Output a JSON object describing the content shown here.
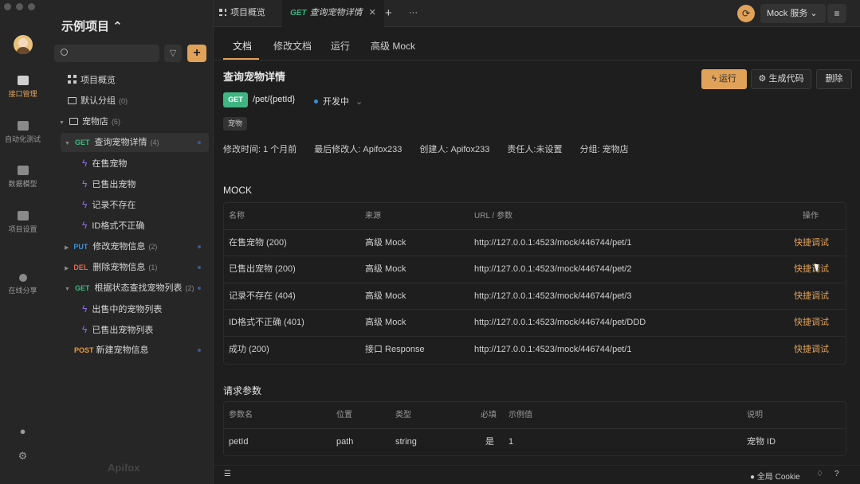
{
  "rail": {
    "items": [
      {
        "label": "接口管理",
        "icon": "api-manage-icon"
      },
      {
        "label": "自动化测试",
        "icon": "automation-icon"
      },
      {
        "label": "数据模型",
        "icon": "data-model-icon"
      },
      {
        "label": "项目设置",
        "icon": "settings-icon"
      },
      {
        "label": "在线分享",
        "icon": "share-icon"
      }
    ]
  },
  "sidebar": {
    "project_title": "示例项目 ⌃",
    "tree": {
      "overview": "项目概览",
      "default_group": "默认分组",
      "default_group_count": "(0)",
      "pet_folder": "宠物店",
      "pet_folder_count": "(5)",
      "api1": {
        "method": "GET",
        "label": "查询宠物详情",
        "count": "(4)"
      },
      "api1_cases": [
        "在售宠物",
        "已售出宠物",
        "记录不存在",
        "ID格式不正确"
      ],
      "api2": {
        "method": "PUT",
        "label": "修改宠物信息",
        "count": "(2)"
      },
      "api3": {
        "method": "DEL",
        "label": "删除宠物信息",
        "count": "(1)"
      },
      "api4": {
        "method": "GET",
        "label": "根据状态查找宠物列表",
        "count": "(2)"
      },
      "api4_cases": [
        "出售中的宠物列表",
        "已售出宠物列表"
      ],
      "api5": {
        "method": "POST",
        "label": "新建宠物信息"
      }
    },
    "brand": "Apifox"
  },
  "topbar": {
    "tab1": "项目概览",
    "tab2_method": "GET",
    "tab2_title": "查询宠物详情",
    "tab_close": "✕",
    "add": "+",
    "more": "···",
    "mock_service": "Mock 服务 ⌄",
    "accent": "#e0a259"
  },
  "subtabs": [
    "文档",
    "修改文档",
    "运行",
    "高级 Mock"
  ],
  "api": {
    "title": "查询宠物详情",
    "run": "运行",
    "gen_code": "生成代码",
    "delete": "删除",
    "method": "GET",
    "path": "/pet/{petId}",
    "status": "开发中",
    "tag": "宠物",
    "meta": {
      "modified": "修改时间: 1 个月前",
      "modifier": "最后修改人: Apifox233",
      "creator": "创建人: Apifox233",
      "owner": "责任人:未设置",
      "group": "分组: 宠物店"
    }
  },
  "mock": {
    "title": "MOCK",
    "headers": {
      "name": "名称",
      "source": "来源",
      "url": "URL / 参数",
      "action": "操作"
    },
    "rows": [
      {
        "name": "在售宠物 (200)",
        "source": "高级 Mock",
        "url": "http://127.0.0.1:4523/mock/446744/pet/1",
        "action": "快捷调试"
      },
      {
        "name": "已售出宠物 (200)",
        "source": "高级 Mock",
        "url": "http://127.0.0.1:4523/mock/446744/pet/2",
        "action": "快捷调试"
      },
      {
        "name": "记录不存在 (404)",
        "source": "高级 Mock",
        "url": "http://127.0.0.1:4523/mock/446744/pet/3",
        "action": "快捷调试"
      },
      {
        "name": "ID格式不正确 (401)",
        "source": "高级 Mock",
        "url": "http://127.0.0.1:4523/mock/446744/pet/DDD",
        "action": "快捷调试"
      },
      {
        "name": "成功 (200)",
        "source": "接口 Response",
        "url": "http://127.0.0.1:4523/mock/446744/pet/1",
        "action": "快捷调试"
      }
    ]
  },
  "params": {
    "title": "请求参数",
    "headers": {
      "name": "参数名",
      "loc": "位置",
      "type": "类型",
      "req": "必填",
      "example": "示例值",
      "desc": "说明"
    },
    "rows": [
      {
        "name": "petId",
        "loc": "path",
        "type": "string",
        "req": "是",
        "example": "1",
        "desc": "宠物 ID"
      }
    ]
  },
  "footer": {
    "cookie": "全局 Cookie"
  }
}
